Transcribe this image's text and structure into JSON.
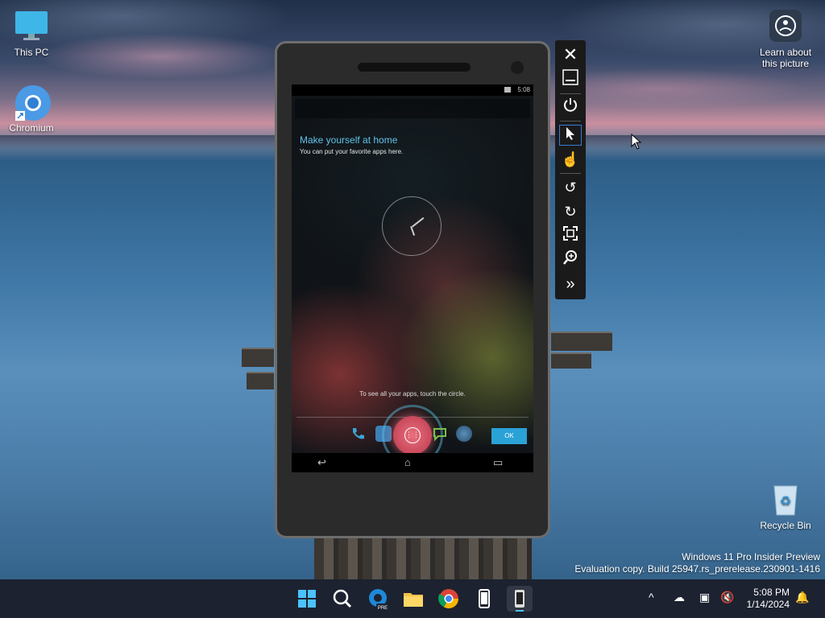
{
  "desktop": {
    "icons": [
      {
        "label": "This PC"
      },
      {
        "label": "Chromium"
      },
      {
        "label": "Recycle Bin"
      }
    ],
    "learn_label": "Learn about this picture",
    "watermark": {
      "line1": "Windows 11 Pro Insider Preview",
      "line2": "Evaluation copy. Build 25947.rs_prerelease.230901-1416"
    }
  },
  "emulator": {
    "status_time": "5:08",
    "home_title": "Make yourself at home",
    "home_subtitle": "You can put your favorite apps here.",
    "hint": "To see all your apps, touch the circle.",
    "ok_label": "OK",
    "toolbar": [
      "close-icon",
      "minimize-icon",
      "power-icon",
      "pointer-icon",
      "touch-icon",
      "rotate-left-icon",
      "rotate-right-icon",
      "fit-screen-icon",
      "zoom-icon",
      "more-icon"
    ]
  },
  "taskbar": {
    "time": "5:08 PM",
    "date": "1/14/2024",
    "apps": [
      "start",
      "search",
      "edge-beta",
      "file-explorer",
      "chrome",
      "phone-emulator",
      "emulator-active"
    ]
  },
  "colors": {
    "android_accent": "#5fc4e8",
    "ok_button": "#2aa2d6",
    "taskbar_bg": "#1c2230"
  }
}
